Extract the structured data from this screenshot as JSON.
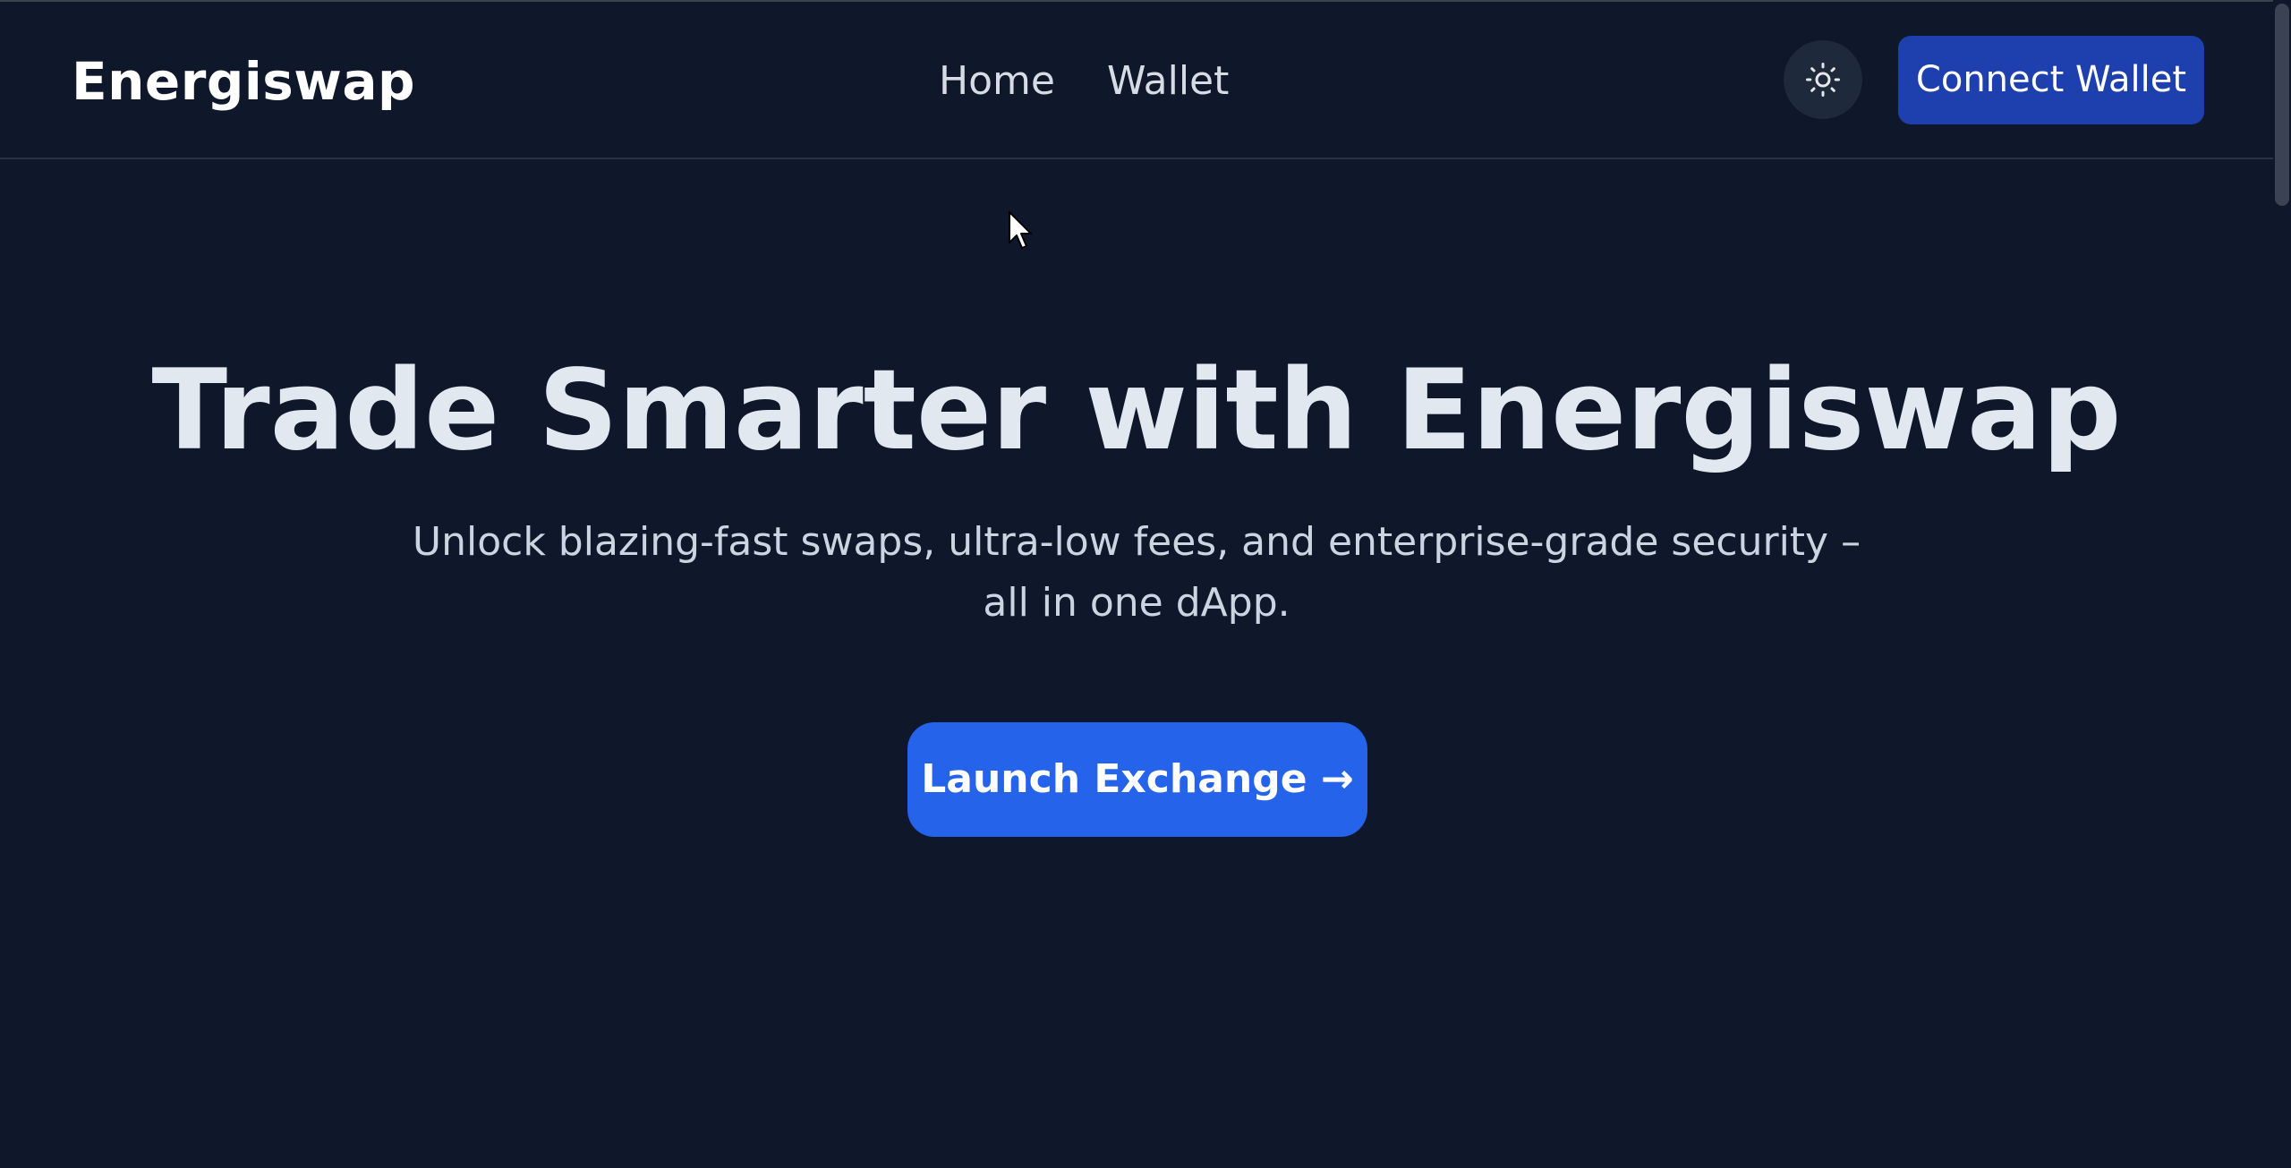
{
  "header": {
    "brand": "Energiswap",
    "nav": [
      {
        "label": "Home"
      },
      {
        "label": "Wallet"
      }
    ],
    "theme_toggle_icon": "sun-icon",
    "connect_label": "Connect Wallet"
  },
  "hero": {
    "title": "Trade Smarter with Energiswap",
    "subtitle": "Unlock blazing-fast swaps, ultra-low fees, and enterprise-grade security – all in one dApp.",
    "cta_label": "Launch Exchange →"
  },
  "colors": {
    "background": "#0f172a",
    "connect_button": "#1e40af",
    "cta_button": "#2563eb",
    "toggle_bg": "#1e293b"
  }
}
